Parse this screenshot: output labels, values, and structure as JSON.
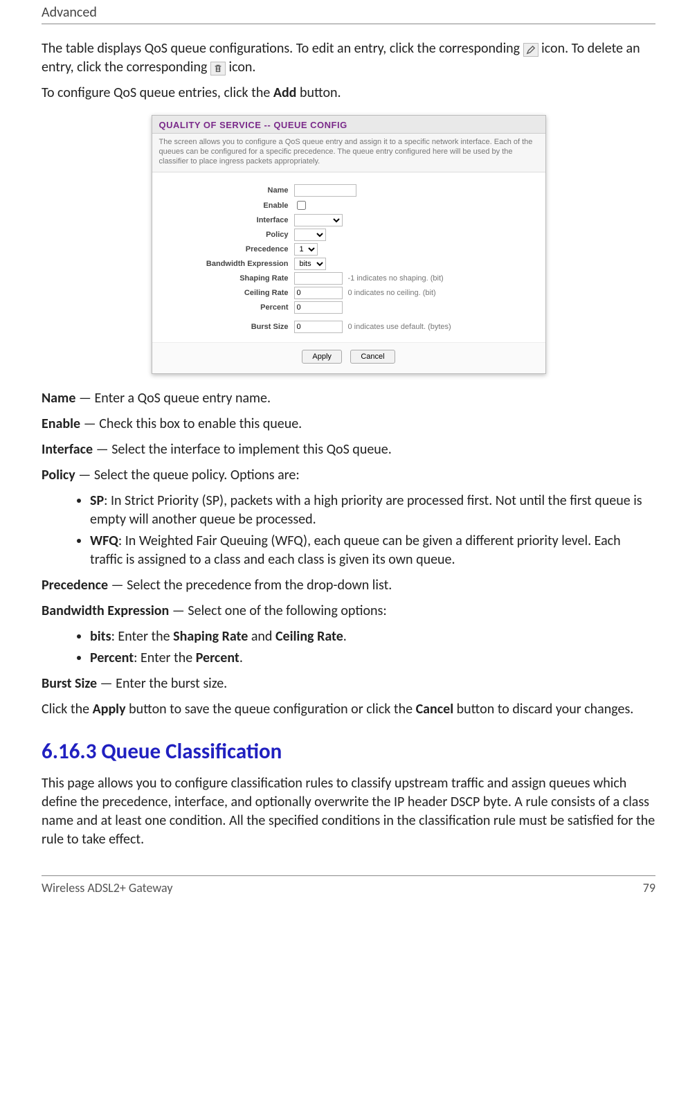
{
  "header": {
    "section": "Advanced"
  },
  "intro": {
    "line1_a": "The table displays QoS queue configurations. To edit an entry, click the corresponding ",
    "line1_b": " icon. To delete an entry, click the corresponding ",
    "line1_c": " icon.",
    "line2_a": "To configure QoS queue entries, click the ",
    "line2_add": "Add",
    "line2_b": " button."
  },
  "shot": {
    "title": "QUALITY OF SERVICE -- QUEUE CONFIG",
    "desc": "The screen allows you to configure a QoS queue entry and assign it to a specific network interface. Each of the queues can be configured for a specific precedence. The queue entry configured here will be used by the classifier to place ingress packets appropriately.",
    "fields": {
      "name": "Name",
      "enable": "Enable",
      "interface": "Interface",
      "policy": "Policy",
      "precedence": "Precedence",
      "bandwidth_expr": "Bandwidth Expression",
      "shaping_rate": "Shaping Rate",
      "ceiling_rate": "Ceiling Rate",
      "percent": "Percent",
      "burst_size": "Burst Size"
    },
    "values": {
      "precedence": "1",
      "bandwidth_expr": "bits",
      "ceiling_rate": "0",
      "percent": "0",
      "burst_size": "0"
    },
    "hints": {
      "shaping": "-1 indicates no shaping. (bit)",
      "ceiling": "0 indicates no ceiling. (bit)",
      "burst": "0 indicates use default. (bytes)"
    },
    "buttons": {
      "apply": "Apply",
      "cancel": "Cancel"
    }
  },
  "defs": {
    "name": {
      "term": "Name",
      "text": " — Enter a QoS queue entry name."
    },
    "enable": {
      "term": "Enable",
      "text": " — Check this box to enable this queue."
    },
    "interface": {
      "term": "Interface",
      "text": " — Select the interface to implement this QoS queue."
    },
    "policy": {
      "term": "Policy",
      "text": " — Select the queue policy. Options are:",
      "sp_term": "SP",
      "sp_text": ": In Strict Priority (SP), packets with a high priority are processed first. Not until the first queue is empty will another queue be processed.",
      "wfq_term": "WFQ",
      "wfq_text": ": In Weighted Fair Queuing (WFQ), each queue can be given a different priority level. Each traffic is assigned to a class and each class is given its own queue."
    },
    "precedence": {
      "term": "Precedence",
      "text": " — Select the precedence from the drop-down list."
    },
    "bw": {
      "term": "Bandwidth Expression",
      "text": " — Select one of the following options:",
      "bits_term": "bits",
      "bits_text_a": ": Enter the ",
      "bits_sr": "Shaping Rate",
      "bits_and": " and ",
      "bits_cr": "Ceiling Rate",
      "bits_text_b": ".",
      "pct_term": "Percent",
      "pct_text_a": ": Enter the ",
      "pct_v": "Percent",
      "pct_text_b": "."
    },
    "burst": {
      "term": "Burst Size",
      "text": " — Enter the burst size."
    },
    "apply": {
      "a": "Click the ",
      "apply": "Apply",
      "b": " button to save the queue configuration or click the ",
      "cancel": "Cancel",
      "c": " button to discard your changes."
    }
  },
  "h3": "6.16.3  Queue Classification",
  "qclass_text": "This page allows you to configure classification rules to classify upstream traffic and assign queues which define the precedence, interface, and optionally overwrite the IP header DSCP byte. A rule consists of a class name and at least one condition. All the specified conditions in the classification rule must be satisfied for the rule to take effect.",
  "footer": {
    "product": "Wireless ADSL2+ Gateway",
    "page": "79"
  }
}
